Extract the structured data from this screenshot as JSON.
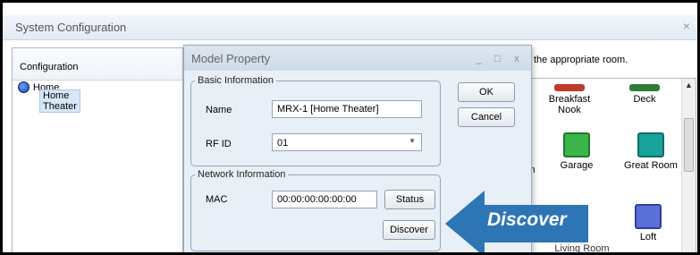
{
  "window": {
    "title": "System Configuration",
    "close_glyph": "×"
  },
  "left_pane": {
    "header": "Configuration",
    "tree": {
      "root_label": "Home",
      "child_label": "Home Theater"
    }
  },
  "right_pane": {
    "hint": "the appropriate room.",
    "rooms": [
      {
        "label_line1": "Breakfast",
        "label_line2": "Nook",
        "color": "#c0392b"
      },
      {
        "label_line1": "Deck",
        "label_line2": "",
        "color": "#2e7d32"
      },
      {
        "label_line1": "m",
        "label_line2": "",
        "color": ""
      },
      {
        "label_line1": "Garage",
        "label_line2": "",
        "color": "#3bb54a"
      },
      {
        "label_line1": "Great Room",
        "label_line2": "",
        "color": "#1aa39a"
      },
      {
        "label_line1": "Living Room",
        "label_line2": "",
        "color": "#1f6ed4"
      },
      {
        "label_line1": "Loft",
        "label_line2": "",
        "color": "#5b6fd8"
      }
    ]
  },
  "modal": {
    "title": "Model Property",
    "controls": {
      "minimize": "_",
      "maximize": "□",
      "close": "x"
    },
    "basic_info": {
      "legend": "Basic Information",
      "name_label": "Name",
      "name_value": "MRX-1 [Home Theater]",
      "rfid_label": "RF ID",
      "rfid_value": "01"
    },
    "network_info": {
      "legend": "Network Information",
      "mac_label": "MAC",
      "mac_value": "00:00:00:00:00:00",
      "status_button": "Status",
      "discover_button": "Discover"
    },
    "ok_button": "OK",
    "cancel_button": "Cancel"
  },
  "callout": {
    "text": "Discover",
    "color": "#2e75b6"
  }
}
